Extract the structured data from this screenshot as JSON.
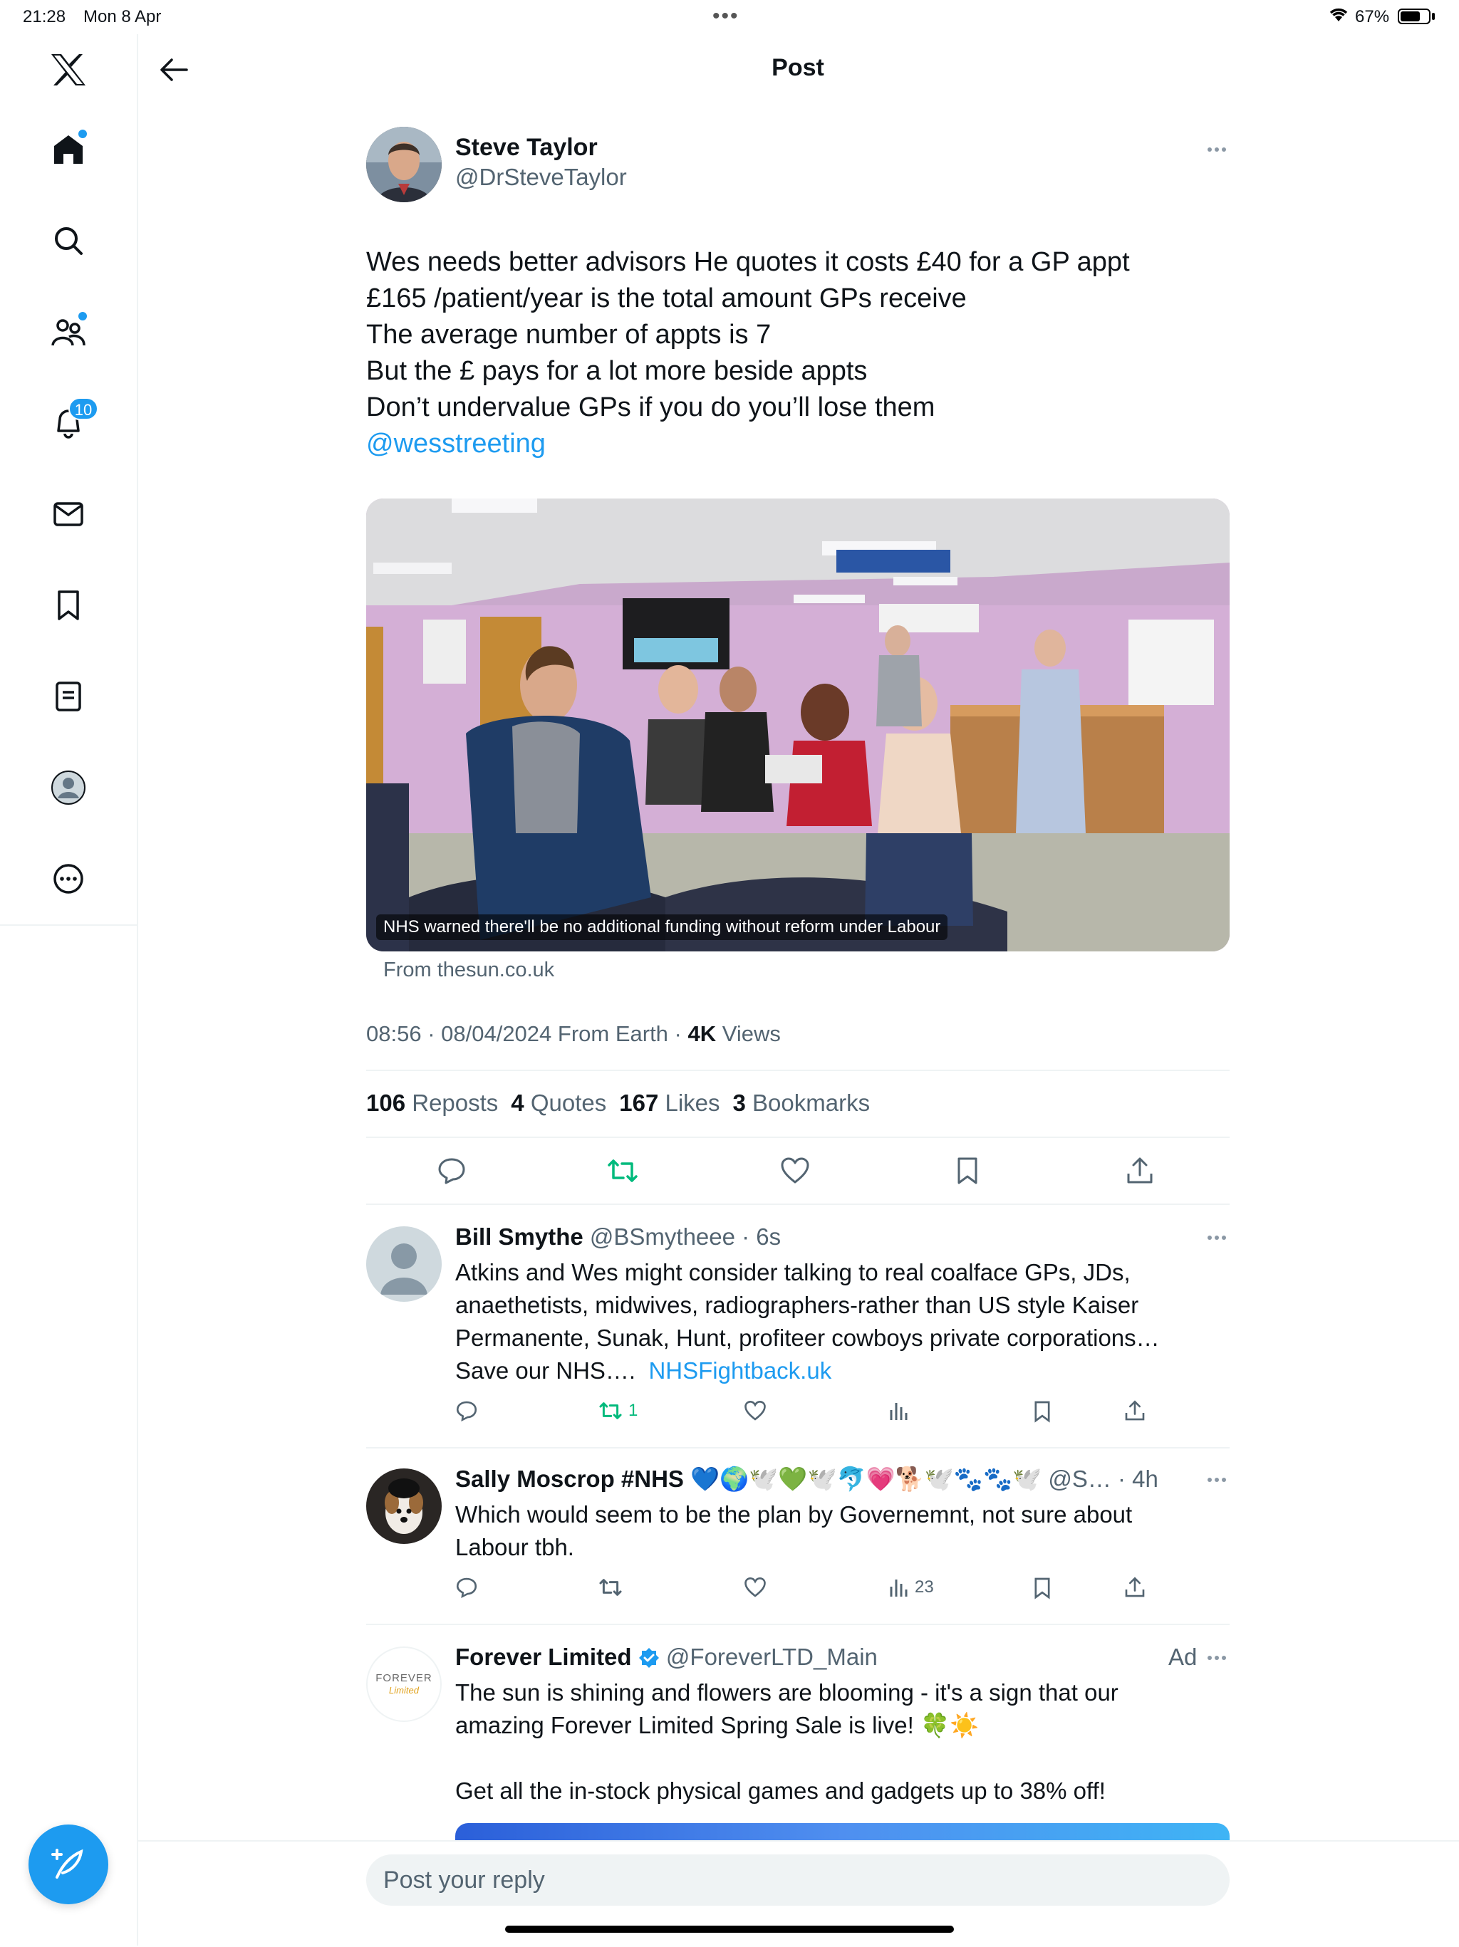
{
  "status_bar": {
    "time": "21:28",
    "date": "Mon 8 Apr",
    "battery": "67%"
  },
  "header": {
    "title": "Post"
  },
  "sidebar": {
    "notifications_badge": "10"
  },
  "post": {
    "author_name": "Steve Taylor",
    "author_handle": "@DrSteveTaylor",
    "lines": [
      "Wes needs better advisors He quotes it costs £40 for a GP appt",
      "£165 /patient/year is the total amount GPs receive",
      "The average number of appts is 7",
      "But the £ pays for a lot more beside appts",
      "Don’t undervalue GPs if you do you’ll lose them"
    ],
    "mention": "@wesstreeting",
    "media_caption": "NHS warned there'll be no additional funding without reform under Labour",
    "media_source": "From thesun.co.uk",
    "timestamp": "08:56 · 08/04/2024 From Earth · ",
    "views_count": "4K",
    "views_label": " Views",
    "stats": {
      "reposts": "106",
      "reposts_label": "Reposts",
      "quotes": "4",
      "quotes_label": "Quotes",
      "likes": "167",
      "likes_label": "Likes",
      "bookmarks": "3",
      "bookmarks_label": "Bookmarks"
    }
  },
  "replies": [
    {
      "name": "Bill Smythe",
      "handle_time": "@BSmytheee · 6s",
      "lines": [
        "Atkins and Wes might consider talking to real coalface GPs, JDs,",
        "anaethetists, midwives, radiographers-rather than US style Kaiser",
        "Permanente, Sunak, Hunt, profiteer cowboys private corporations…"
      ],
      "last_line_text": "Save our NHS….",
      "link": "NHSFightback.uk",
      "repost_count": "1"
    },
    {
      "name": "Sally Moscrop #NHS 💙🌍🕊️💚🕊️🐬💗🐕🕊️🐾🐾🕊️",
      "handle_time": "@S… · 4h",
      "lines": [
        "Which would seem to be the plan by Governemnt, not sure about",
        "Labour tbh."
      ],
      "views_count": "23"
    },
    {
      "name": "Forever Limited",
      "handle": "@ForeverLTD_Main",
      "ad_label": "Ad",
      "logo_text": "FOREVER",
      "logo_sub": "Limited",
      "lines": [
        "The sun is shining and flowers are blooming - it's a sign that our",
        "amazing Forever Limited Spring Sale is live! 🍀☀️"
      ],
      "line3": "Get all the in-stock physical games and gadgets up to 38% off!"
    }
  ],
  "composer": {
    "placeholder": "Post your reply"
  },
  "colors": {
    "accent": "#1d9bf0",
    "repost_green": "#00ba7c",
    "text_secondary": "#536471"
  }
}
